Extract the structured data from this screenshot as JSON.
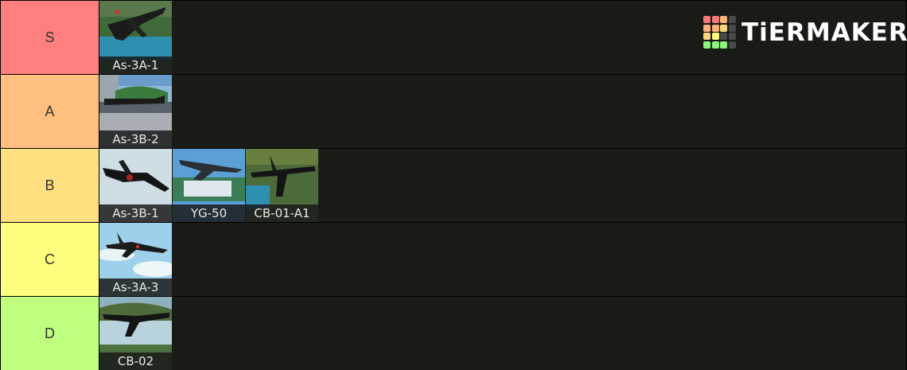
{
  "logo": {
    "text": "TiERMAKER",
    "cell_colors": [
      "#f47a7a",
      "#f47a7a",
      "#f9b27a",
      "#4a4a4a",
      "#f9b27a",
      "#f9b27a",
      "#fbd67a",
      "#4a4a4a",
      "#fbd67a",
      "#fdfd7f",
      "#4a4a4a",
      "#4a4a4a",
      "#8df57a",
      "#8df57a",
      "#8df57a",
      "#4a4a4a"
    ]
  },
  "tiers": [
    {
      "label": "S",
      "color": "#ff7f7f",
      "items": [
        {
          "name": "As-3A-1",
          "icon": "plane-photo-icon"
        }
      ]
    },
    {
      "label": "A",
      "color": "#ffbf7f",
      "items": [
        {
          "name": "As-3B-2",
          "icon": "plane-photo-icon"
        }
      ]
    },
    {
      "label": "B",
      "color": "#ffdf7f",
      "items": [
        {
          "name": "As-3B-1",
          "icon": "plane-photo-icon"
        },
        {
          "name": "YG-50",
          "icon": "plane-photo-icon"
        },
        {
          "name": "CB-01-A1",
          "icon": "plane-photo-icon"
        }
      ]
    },
    {
      "label": "C",
      "color": "#ffff7f",
      "items": [
        {
          "name": "As-3A-3",
          "icon": "plane-photo-icon"
        }
      ]
    },
    {
      "label": "D",
      "color": "#bfff7f",
      "items": [
        {
          "name": "CB-02",
          "icon": "plane-photo-icon"
        }
      ]
    }
  ]
}
